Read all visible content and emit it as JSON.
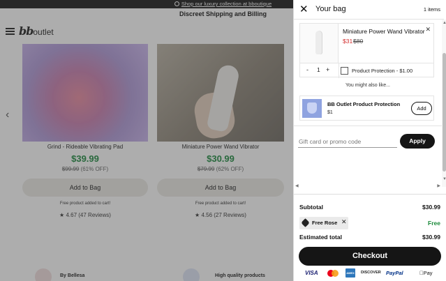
{
  "store": {
    "promo_bar": "Shop our luxury collection at bboutique",
    "shipping_line": "Discreet Shipping and Billing",
    "logo_main": "bb",
    "logo_sub": "outlet",
    "products": [
      {
        "title": "Grind - Rideable Vibrating Pad",
        "price": "$39.99",
        "was": "$99.99",
        "discount": "(61% OFF)",
        "cta": "Add to Bag",
        "free_note": "Free product added to cart!",
        "rating": "4.67",
        "reviews": "(47 Reviews)"
      },
      {
        "title": "Miniature Power Wand Vibrator",
        "price": "$30.99",
        "was": "$79.99",
        "discount": "(62% OFF)",
        "cta": "Add to Bag",
        "free_note": "Free product added to cart!",
        "rating": "4.56",
        "reviews": "(27 Reviews)"
      }
    ],
    "badges": [
      "By Bellesa",
      "High quality products"
    ]
  },
  "cart": {
    "title": "Your bag",
    "item_count": "1 items",
    "item": {
      "name": "Miniature Power Wand Vibrator",
      "price": "$31",
      "was": "$80",
      "qty_minus": "-",
      "qty": "1",
      "qty_plus": "+",
      "protection_label": "Product Protection - $1.00"
    },
    "also_like": "You might also like...",
    "upsell": {
      "name": "BB Outlet Product Protection",
      "price": "$1",
      "add_label": "Add"
    },
    "promo": {
      "placeholder": "Gift card or promo code",
      "value": "",
      "apply_label": "Apply"
    },
    "summary": {
      "subtotal_label": "Subtotal",
      "subtotal": "$30.99",
      "discount_chip": "Free Rose",
      "discount_value": "Free",
      "total_label": "Estimated total",
      "total": "$30.99",
      "checkout_label": "Checkout"
    },
    "payment_methods": [
      "VISA",
      "AMEX",
      "DISCOVER",
      "PayPal",
      "Pay"
    ]
  },
  "icons": {
    "close": "close-icon",
    "menu": "hamburger-icon",
    "tag": "tag-icon",
    "shield": "shield-icon"
  },
  "colors": {
    "sale_green": "#1c8a3f",
    "sale_red": "#d32f2f",
    "button_dark": "#151515"
  }
}
